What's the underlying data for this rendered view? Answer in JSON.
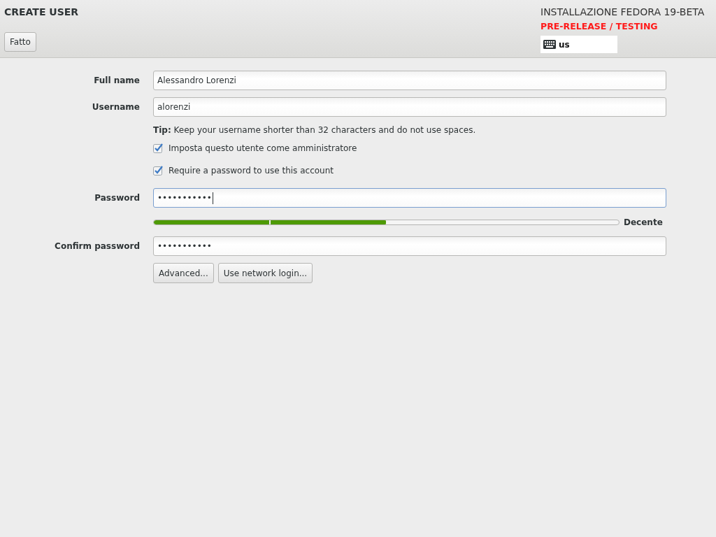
{
  "header": {
    "title": "CREATE USER",
    "done_button": "Fatto",
    "product": "INSTALLAZIONE FEDORA 19-BETA",
    "warning": "PRE-RELEASE / TESTING",
    "keyboard_layout": "us"
  },
  "form": {
    "fields": [
      {
        "kind": "text",
        "label": "Full name",
        "value": "Alessandro Lorenzi",
        "focused": false
      },
      {
        "kind": "text",
        "label": "Username",
        "value": "alorenzi",
        "focused": false
      },
      {
        "kind": "tip",
        "text": "**Tip:** Keep your username shorter than 32 characters and do not use spaces."
      },
      {
        "kind": "checkbox",
        "label": "Imposta questo utente come amministratore",
        "checked": true
      },
      {
        "kind": "checkbox",
        "label": "Require a password to use this account",
        "checked": true
      },
      {
        "kind": "text",
        "label": "Password",
        "value": "•••••••••••",
        "focused": true
      },
      {
        "kind": "strength",
        "level": 0.5,
        "reading": "Decente"
      },
      {
        "kind": "text",
        "label": "Confirm password",
        "value": "•••••••••••",
        "focused": false
      },
      {
        "kind": "buttons",
        "buttons": [
          "Advanced...",
          "Use network login..."
        ]
      }
    ]
  }
}
